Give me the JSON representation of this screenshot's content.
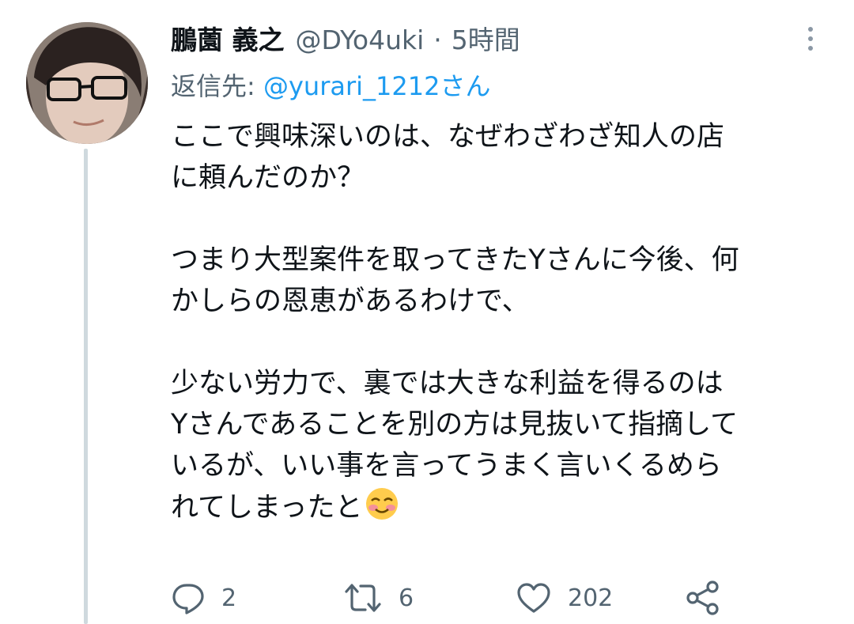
{
  "tweet": {
    "display_name": "鵬薗 義之",
    "handle": "@DYo4uki",
    "separator": "·",
    "time": "5時間",
    "reply_prefix": "返信先: ",
    "reply_handle": "@yurari_1212さん",
    "text_lines": [
      "ここで興味深いのは、なぜわざわざ知人の店",
      "に頼んだのか？",
      "",
      "つまり大型案件を取ってきたYさんに今後、何",
      "かしらの恩恵があるわけで、",
      "",
      "少ない労力で、裏では大きな利益を得るのは",
      "Yさんであることを別の方は見抜いて指摘して",
      "いるが、いい事を言ってうまく言いくるめら",
      "れてしまったと"
    ],
    "trailing_emoji": "smiling-face-emoji"
  },
  "actions": {
    "reply": {
      "icon": "reply-icon",
      "count": "2"
    },
    "retweet": {
      "icon": "retweet-icon",
      "count": "6"
    },
    "like": {
      "icon": "heart-icon",
      "count": "202"
    },
    "share": {
      "icon": "share-icon"
    }
  },
  "colors": {
    "text": "#0f1419",
    "secondary": "#536471",
    "link": "#1d9bf0",
    "thread_line": "#cfd9de"
  }
}
